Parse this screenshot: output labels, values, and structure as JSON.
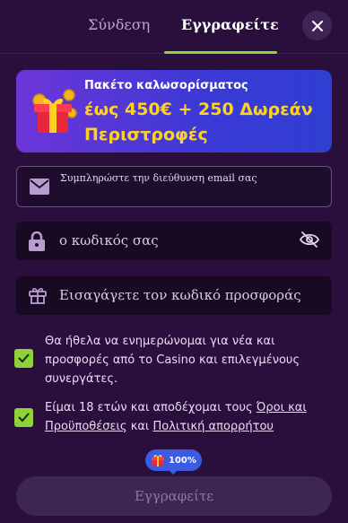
{
  "tabs": {
    "login": "Σύνδεση",
    "register": "Εγγραφείτε"
  },
  "banner": {
    "title": "Πακέτο καλωσορίσματος",
    "amount": "έως 450€ + 250 Δωρεάν Περιστροφές"
  },
  "form": {
    "email_placeholder": "Συμπληρώστε την διεύθυνση email σας",
    "password_placeholder": "ο κωδικός σας",
    "promo_placeholder": "Εισαγάγετε τον κωδικό προσφοράς"
  },
  "consents": {
    "newsletter": "Θα ήθελα να ενημερώνομαι για νέα και προσφορές από το Casino και επιλεγμένους συνεργάτες.",
    "age_prefix": "Είμαι 18 ετών και αποδέχομαι τους ",
    "terms_link": "Όροι και Προϋποθέσεις",
    "age_mid": " και ",
    "privacy_link": "Πολιτική απορρήτου",
    "newsletter_checked": true,
    "age_checked": true
  },
  "progress": {
    "label": "100%",
    "value": 1.0
  },
  "submit_label": "Εγγραφείτε",
  "colors": {
    "background": "#2a0f3d",
    "accent_green": "#8fd13a",
    "banner_amount": "#ffd21f",
    "badge_blue": "#3b5be0"
  },
  "icons": {
    "close": "close-icon",
    "email": "envelope-icon",
    "password": "lock-icon",
    "eye": "eye-off-icon",
    "promo": "gift-icon",
    "banner": "gift-box-icon"
  }
}
